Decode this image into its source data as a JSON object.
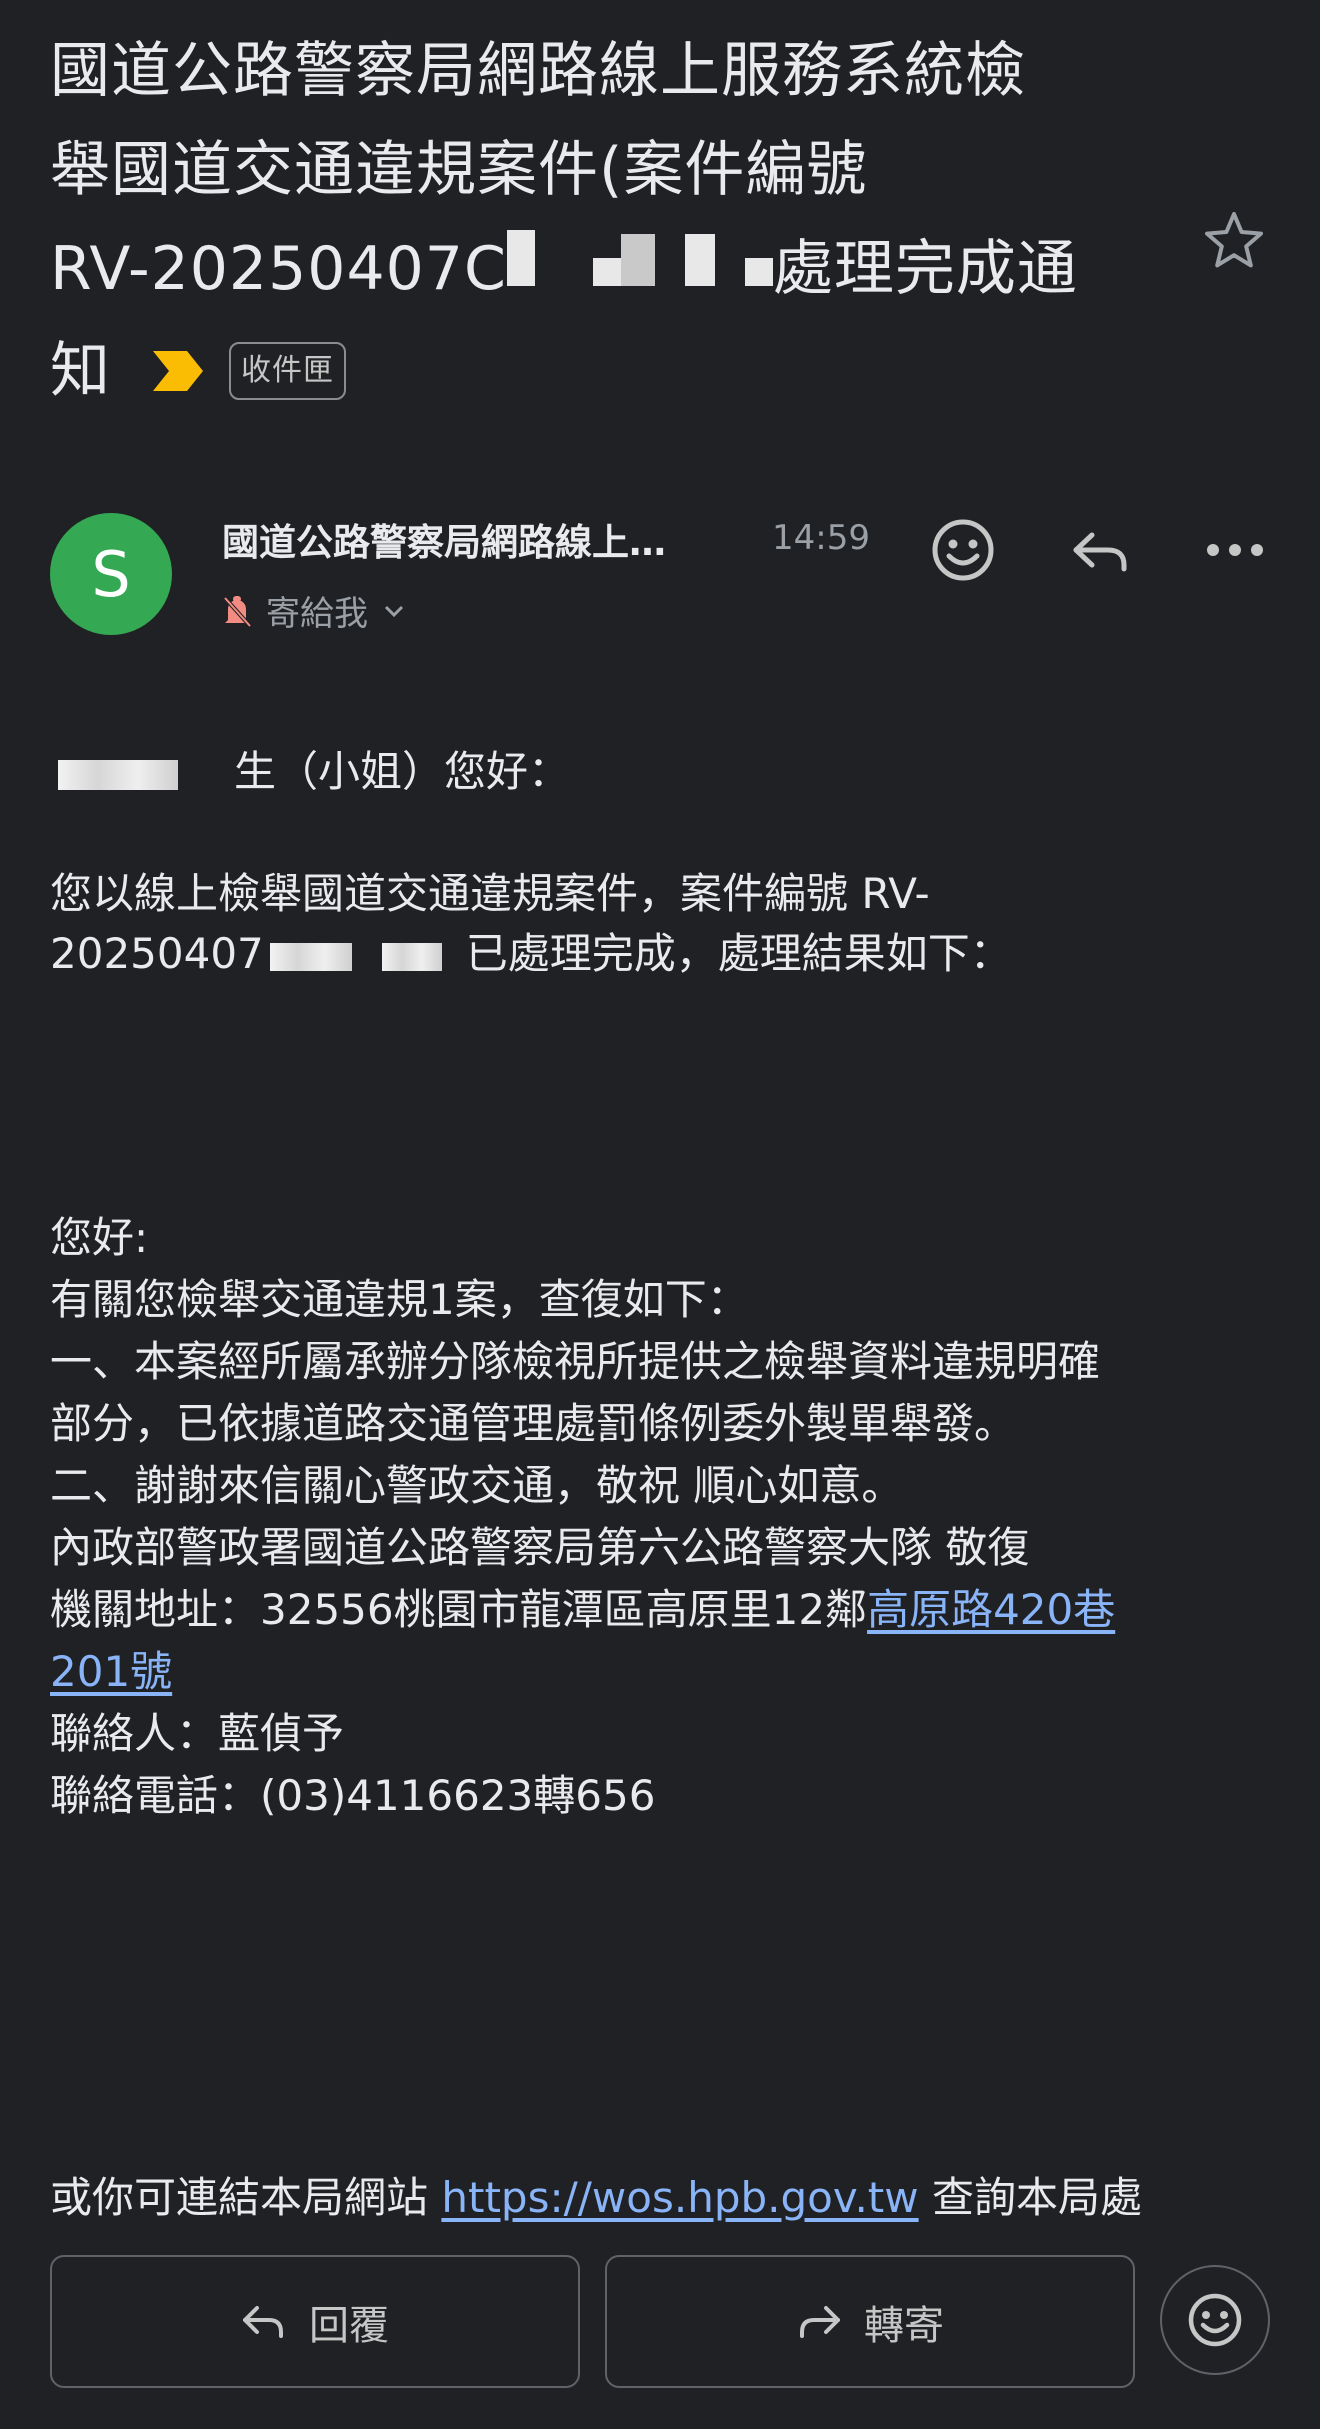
{
  "subject": {
    "line1": "國道公路警察局網路線上服務系統檢",
    "line2": "舉國道交通違規案件(案件編號",
    "line3_prefix": "RV-20250407C",
    "line3_suffix": "處理完成通",
    "line4": "知",
    "label": "收件匣"
  },
  "sender": {
    "avatar_letter": "S",
    "name": "國道公路警察局網路線上…",
    "time": "14:59",
    "to": "寄給我"
  },
  "body": {
    "greeting_suffix": "生（小姐）您好：",
    "intro_line1": "您以線上檢舉國道交通違規案件，案件編號 RV-",
    "intro_line2_prefix": "20250407",
    "intro_line2_suffix": "已處理完成，處理結果如下：",
    "reply_hello": "您好:",
    "reply_line1": "有關您檢舉交通違規1案，查復如下：",
    "reply_line2": "一、本案經所屬承辦分隊檢視所提供之檢舉資料違規明確",
    "reply_line3": "部分，已依據道路交通管理處罰條例委外製單舉發。",
    "reply_line4": "二、謝謝來信關心警政交通，敬祝 順心如意。",
    "reply_line5": "內政部警政署國道公路警察局第六公路警察大隊 敬復",
    "address_prefix": "機關地址：32556桃園市龍潭區高原里12鄰",
    "address_link_part1": "高原路420巷",
    "address_link_part2": "201號",
    "contact": "聯絡人：藍偵予",
    "phone": "聯絡電話：(03)4116623轉656",
    "website_prefix": "或你可連結本局網站",
    "website_link": "https://wos.hpb.gov.tw",
    "website_suffix": "查詢本局處"
  },
  "actions": {
    "reply_label": "回覆",
    "forward_label": "轉寄"
  },
  "colors": {
    "background": "#202124",
    "avatar": "#34a853",
    "link": "#8ab4f8",
    "importance": "#fbbc04",
    "muted": "#9aa0a6"
  },
  "icons": [
    "star-icon",
    "importance-marker-icon",
    "emoji-icon",
    "reply-icon",
    "more-icon",
    "muted-bell-icon",
    "chevron-down-icon",
    "forward-icon"
  ]
}
